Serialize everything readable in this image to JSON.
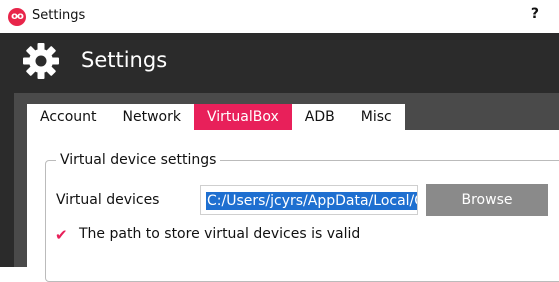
{
  "window": {
    "icon_text": "oo",
    "title": "Settings",
    "help_label": "?"
  },
  "header": {
    "icon": "gear-icon",
    "title": "Settings"
  },
  "tabs": [
    {
      "label": "Account",
      "active": false
    },
    {
      "label": "Network",
      "active": false
    },
    {
      "label": "VirtualBox",
      "active": true
    },
    {
      "label": "ADB",
      "active": false
    },
    {
      "label": "Misc",
      "active": false
    }
  ],
  "virtual_device_settings": {
    "group_title": "Virtual device settings",
    "virtual_devices_label": "Virtual devices",
    "path_value": "C:/Users/jcyrs/AppData/Local/G",
    "browse_label": "Browse",
    "validation_icon": "checkmark-icon",
    "validation_message": "The path to store virtual devices is valid"
  },
  "colors": {
    "accent": "#e8205a",
    "header_bg": "#2b2b2b",
    "selection": "#1e6fd0",
    "button_bg": "#8a8a8a"
  }
}
